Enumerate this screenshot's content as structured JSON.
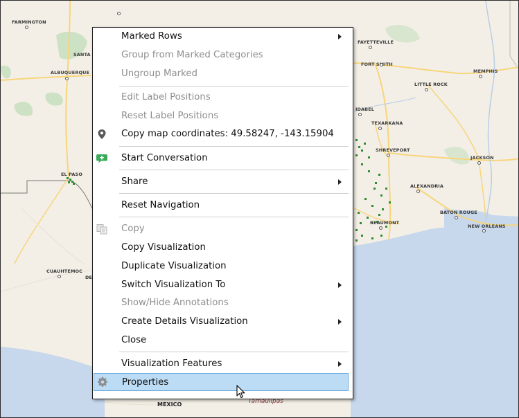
{
  "map": {
    "cities": [
      {
        "name": "FARMINGTON"
      },
      {
        "name": "SANTA FE"
      },
      {
        "name": "ALBUQUERQUE"
      },
      {
        "name": "EL PASO"
      },
      {
        "name": "CUAUHTEMOC"
      },
      {
        "name": "FAYETTEVILLE"
      },
      {
        "name": "FORT SMITH"
      },
      {
        "name": "MEMPHIS"
      },
      {
        "name": "LITTLE ROCK"
      },
      {
        "name": "IDABEL"
      },
      {
        "name": "TEXARKANA"
      },
      {
        "name": "SHREVEPORT"
      },
      {
        "name": "JACKSON"
      },
      {
        "name": "ALEXANDRIA"
      },
      {
        "name": "BATON ROUGE"
      },
      {
        "name": "NEW ORLEANS"
      },
      {
        "name": "BEAUMONT"
      },
      {
        "name": "DEL"
      }
    ],
    "country_label": "MEXICO",
    "region_label": "Tamaulipas",
    "colors": {
      "land": "#f3efe6",
      "water": "#c7d7ec",
      "park": "#cde1c4",
      "roads": "#f7d57a",
      "points": "#2e8b2e"
    }
  },
  "menu": {
    "items": [
      {
        "label": "Marked Rows",
        "submenu": true,
        "enabled": true
      },
      {
        "label": "Group from Marked Categories",
        "enabled": false
      },
      {
        "label": "Ungroup Marked",
        "enabled": false
      },
      {
        "label": "Edit Label Positions",
        "enabled": false
      },
      {
        "label": "Reset Label Positions",
        "enabled": false
      },
      {
        "label": "Copy map coordinates: 49.58247, -143.15904",
        "enabled": true,
        "icon": "map-pin-icon"
      },
      {
        "label": "Start Conversation",
        "enabled": true,
        "icon": "add-conversation-icon"
      },
      {
        "label": "Share",
        "submenu": true,
        "enabled": true
      },
      {
        "label": "Reset Navigation",
        "enabled": true
      },
      {
        "label": "Copy",
        "enabled": false,
        "icon": "copy-icon"
      },
      {
        "label": "Copy Visualization",
        "enabled": true
      },
      {
        "label": "Duplicate Visualization",
        "enabled": true
      },
      {
        "label": "Switch Visualization To",
        "submenu": true,
        "enabled": true
      },
      {
        "label": "Show/Hide Annotations",
        "enabled": false
      },
      {
        "label": "Create Details Visualization",
        "submenu": true,
        "enabled": true
      },
      {
        "label": "Close",
        "enabled": true
      },
      {
        "label": "Visualization Features",
        "submenu": true,
        "enabled": true
      },
      {
        "label": "Properties",
        "enabled": true,
        "icon": "gear-icon",
        "highlighted": true
      }
    ],
    "colors": {
      "highlight": "#bcdcf6",
      "highlight_border": "#6aa7dc",
      "disabled_text": "#8e8e8e"
    }
  }
}
